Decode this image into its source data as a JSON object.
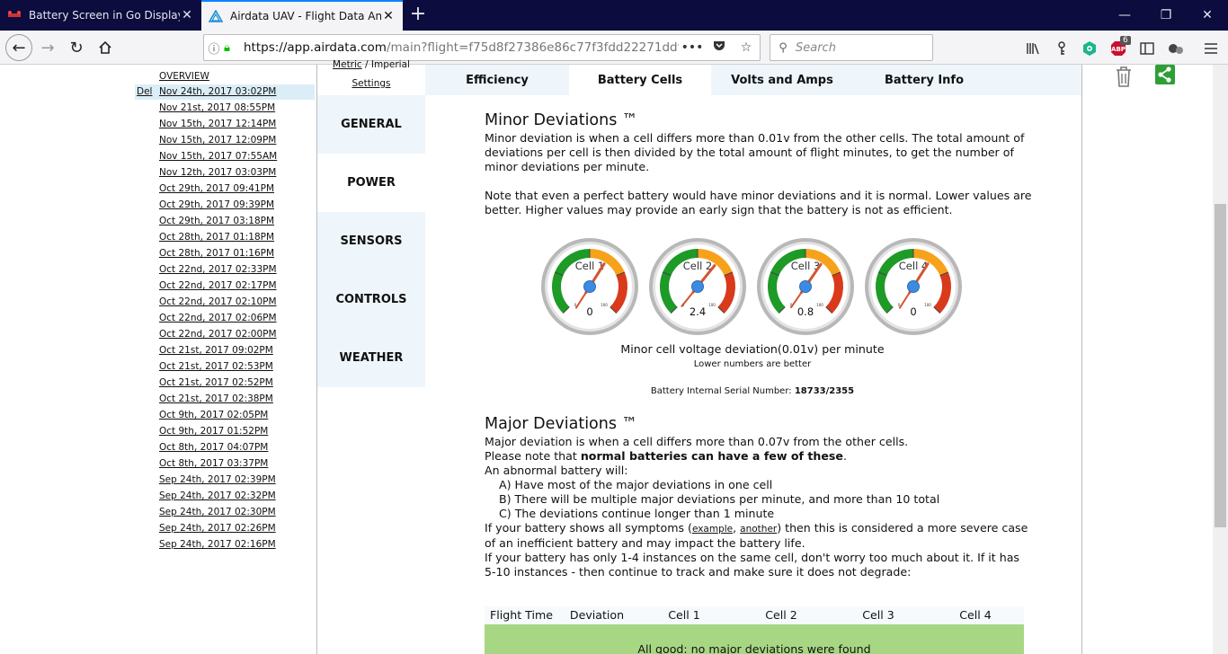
{
  "browser": {
    "tabs": [
      {
        "title": "Battery Screen in Go Display un",
        "close": "✕"
      },
      {
        "title": "Airdata UAV - Flight Data Analy",
        "close": "✕"
      }
    ],
    "new_tab": "+",
    "window_controls": {
      "minimize": "—",
      "restore": "❐",
      "close": "✕"
    },
    "url_host": "https://app.airdata.com",
    "url_path": "/main?flight=f75d8f27386e86c77f3fdd22271ddfa",
    "url_more": "•••",
    "search_placeholder": "Search",
    "adblock_count": "6"
  },
  "flights": {
    "overview_label": "OVERVIEW",
    "delete_label": "Del",
    "items": [
      "Nov 24th, 2017 03:02PM",
      "Nov 21st, 2017 08:55PM",
      "Nov 15th, 2017 12:14PM",
      "Nov 15th, 2017 12:09PM",
      "Nov 15th, 2017 07:55AM",
      "Nov 12th, 2017 03:03PM",
      "Oct 29th, 2017 09:41PM",
      "Oct 29th, 2017 09:39PM",
      "Oct 29th, 2017 03:18PM",
      "Oct 28th, 2017 01:18PM",
      "Oct 28th, 2017 01:16PM",
      "Oct 22nd, 2017 02:33PM",
      "Oct 22nd, 2017 02:17PM",
      "Oct 22nd, 2017 02:10PM",
      "Oct 22nd, 2017 02:06PM",
      "Oct 22nd, 2017 02:00PM",
      "Oct 21st, 2017 09:02PM",
      "Oct 21st, 2017 02:53PM",
      "Oct 21st, 2017 02:52PM",
      "Oct 21st, 2017 02:38PM",
      "Oct 9th, 2017 02:05PM",
      "Oct 9th, 2017 01:52PM",
      "Oct 8th, 2017 04:07PM",
      "Oct 8th, 2017 03:37PM",
      "Sep 24th, 2017 02:39PM",
      "Sep 24th, 2017 02:32PM",
      "Sep 24th, 2017 02:30PM",
      "Sep 24th, 2017 02:26PM",
      "Sep 24th, 2017 02:16PM"
    ]
  },
  "units": {
    "metric": "Metric",
    "sep": " / Imperial",
    "settings": "Settings"
  },
  "tabs": [
    "Efficiency",
    "Battery Cells",
    "Volts and Amps",
    "Battery Info"
  ],
  "sidenav": [
    "GENERAL",
    "POWER",
    "SENSORS",
    "CONTROLS",
    "WEATHER"
  ],
  "minor": {
    "title": "Minor Deviations ™",
    "p1": "Minor deviation is when a cell differs more than 0.01v from the other cells. The total amount of deviations per cell is then divided by the total amount of flight minutes, to get the number of minor deviations per minute.",
    "p2": "Note that even a perfect battery would have minor deviations and it is normal. Lower values are better. Higher values may provide an early sign that the battery is not as efficient.",
    "caption": "Minor cell voltage deviation(0.01v) per minute",
    "subcaption": "Lower numbers are better",
    "serial_label": "Battery Internal Serial Number:",
    "serial_value": "18733/2355"
  },
  "gauges": [
    {
      "label": "Cell 1",
      "value": 0,
      "display": "0"
    },
    {
      "label": "Cell 2",
      "value": 2.4,
      "display": "2.4"
    },
    {
      "label": "Cell 3",
      "value": 0.8,
      "display": "0.8"
    },
    {
      "label": "Cell 4",
      "value": 0,
      "display": "0"
    }
  ],
  "gauge_scale": {
    "min_label": "0",
    "max_label": "100"
  },
  "gauge_colors": {
    "green": "#1e9a26",
    "orange": "#f7a21b",
    "red": "#d93a1b",
    "needle": "#d4532e",
    "hub": "#3c8be0"
  },
  "major": {
    "title": "Major Deviations ™",
    "l1": "Major deviation is when a cell differs more than 0.07v from the other cells.",
    "l2a": "Please note that ",
    "l2b": "normal batteries can have a few of these",
    "l2c": ".",
    "l3": "An abnormal battery will:",
    "a": "A) Have most of the major deviations in one cell",
    "b": "B) There will be multiple major deviations per minute, and more than 10 total",
    "c": "C) The deviations continue longer than 1 minute",
    "l4a": "If your battery shows all symptoms (",
    "l4_example": "example",
    "l4_comma": ", ",
    "l4_another": "another",
    "l4b": ") then this is considered a more severe case of an inefficient battery and may impact the battery life.",
    "l5": "If your battery has only 1-4 instances on the same cell, don't worry too much about it. If it has 5-10 instances - then continue to track and make sure it does not degrade:"
  },
  "table": {
    "columns": [
      "Flight Time",
      "Deviation",
      "Cell 1",
      "Cell 2",
      "Cell 3",
      "Cell 4"
    ],
    "status": "All good: no major deviations were found"
  }
}
